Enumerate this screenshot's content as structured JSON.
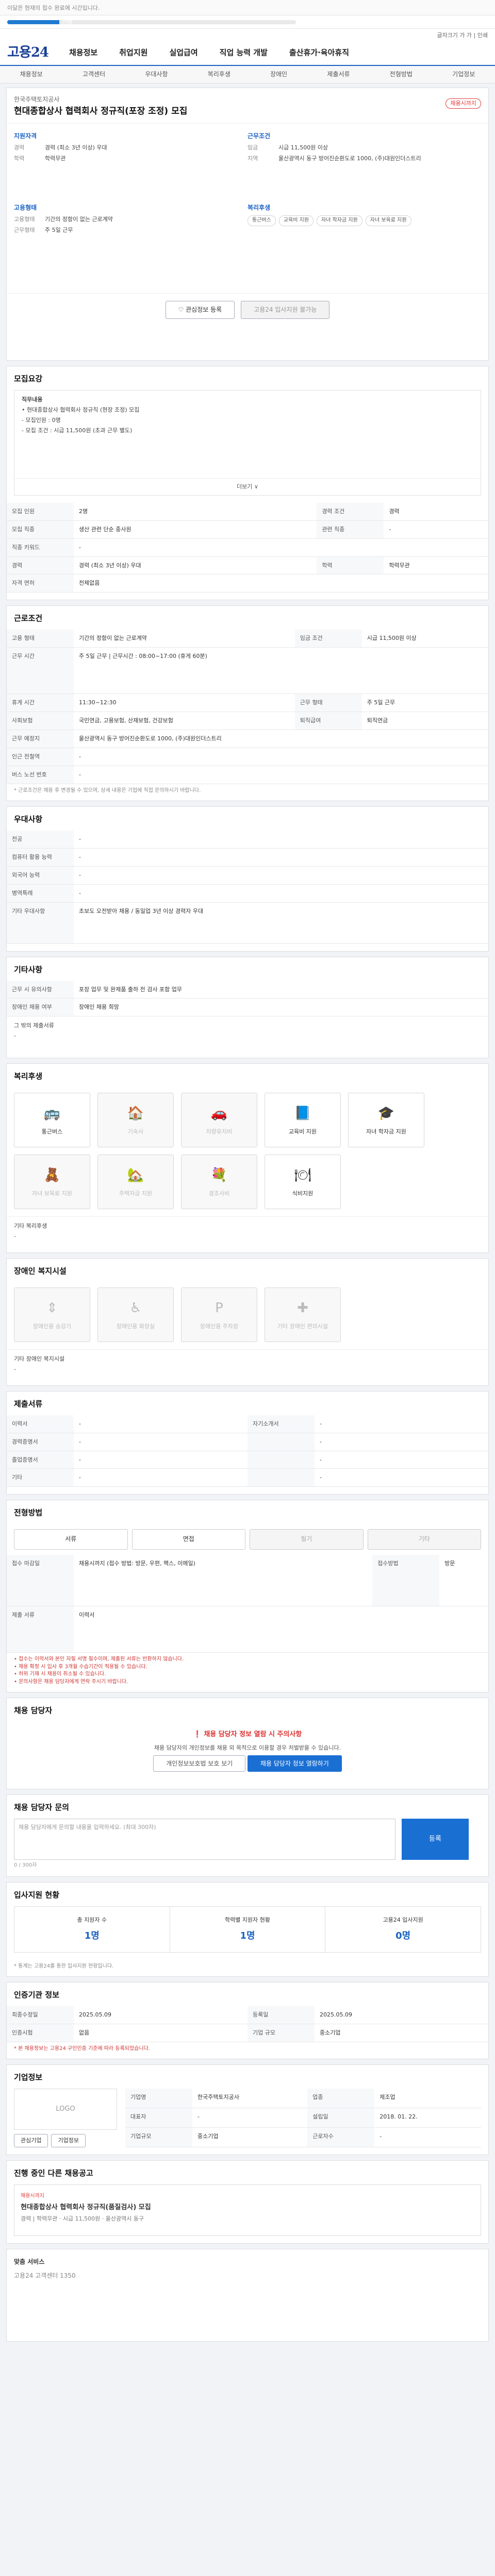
{
  "topbar": {
    "text": "이달은 현재의 접수 완료에 시간입니다."
  },
  "progress": {
    "label": "진행",
    "value": 18
  },
  "fonttools": {
    "text": "글자크기 가 가 | 인쇄"
  },
  "gnb": {
    "logo": "고용24",
    "items": [
      "채용정보",
      "취업지원",
      "실업급여",
      "직업 능력 개발",
      "출산휴가·육아휴직"
    ]
  },
  "tabs": [
    "채용정보",
    "고객센터",
    "우대사항",
    "복리후생",
    "장애인",
    "제출서류",
    "전형방법",
    "기업정보"
  ],
  "job": {
    "corp": "한국주택토지공사",
    "title": "현대종합상사 협력회사 정규직(포장 조정) 모집",
    "badge": "채용시까지",
    "qual_h": "지원자격",
    "qual": [
      [
        "경력",
        "경력 (최소 3년 이상) 우대"
      ],
      [
        "학력",
        "학력무관"
      ]
    ],
    "cond_h": "근무조건",
    "cond": [
      [
        "임금",
        "시급 11,500원 이상"
      ],
      [
        "지역",
        "울산광역시 동구 방어진순환도로 1000, (주)대원인더스트리"
      ]
    ],
    "form_h": "고용형태",
    "form": [
      [
        "고용형태",
        "기간의 정함이 없는 근로계약"
      ],
      [
        "근무형태",
        "주 5일 근무"
      ]
    ],
    "welfare_h": "복리후생",
    "welfare": [
      "통근버스",
      "교육비 지원",
      "자녀 학자금 지원",
      "자녀 보육료 지원"
    ],
    "btn_scrap": "관심정보 등록",
    "btn_apply": "고용24 입사지원 불가능"
  },
  "recruit": {
    "title": "모집요강",
    "duty_h": "직무내용",
    "duties": [
      "• 현대종합상사 협력회사 정규직 (현장 조정) 모집",
      "- 모집인원 : 0명",
      "- 모집 조건 : 시급 11,500원 (초과 근무 별도)"
    ],
    "more": "더보기 ∨",
    "rows": [
      [
        "모집 인원",
        "2명",
        "경력 조건",
        "경력"
      ],
      [
        "모집 직종",
        "생산 관련 단순 종사원",
        "관련 직종",
        "-"
      ],
      [
        "직종 키워드",
        "-",
        "",
        ""
      ],
      [
        "경력",
        "경력 (최소 3년 이상) 우대",
        "학력",
        "학력무관"
      ],
      [
        "자격 면허",
        "전체없음",
        "",
        ""
      ]
    ]
  },
  "cond": {
    "title": "근로조건",
    "rows": [
      [
        "고용 형태",
        "기간의 정함이 없는 근로계약",
        "임금 조건",
        "시급 11,500원 이상"
      ],
      [
        "근무 시간",
        "주 5일 근무 | 근무시간 : 08:00~17:00 (휴게 60분)",
        "",
        ""
      ],
      [
        "휴게 시간",
        "11:30~12:30",
        "근무 형태",
        "주 5일 근무"
      ],
      [
        "사회보험",
        "국민연금, 고용보험, 산재보험, 건강보험",
        "퇴직급여",
        "퇴직연금"
      ],
      [
        "근무 예정지",
        "울산광역시 동구 방어진순환도로 1000, (주)대원인더스트리",
        "",
        ""
      ],
      [
        "인근 전철역",
        "-",
        "",
        ""
      ],
      [
        "버스 노선 번호",
        "-",
        "",
        ""
      ]
    ],
    "note": "* 근로조건은 채용 후 변경될 수 있으며, 상세 내용은 기업에 직접 문의하시기 바랍니다."
  },
  "prefer": {
    "title": "우대사항",
    "rows": [
      [
        "전공",
        "-"
      ],
      [
        "컴퓨터 활용 능력",
        "-"
      ],
      [
        "외국어 능력",
        "-"
      ],
      [
        "병역특례",
        "-"
      ],
      [
        "기타 우대사항",
        "초보도 오전받아 채용 / 동일업 3년 이상 경력자 우대"
      ]
    ]
  },
  "etc": {
    "title": "기타사항",
    "rows": [
      [
        "근무 시 유의사항",
        "포장 업무 및 완제품 출하 전 검사 포함 업무"
      ],
      [
        "장애인 채용 여부",
        "장애인 채용 희망"
      ]
    ],
    "remark_h": "그 밖의 제출서류",
    "remark": "-"
  },
  "welfare": {
    "title": "복리후생",
    "items": [
      [
        "통근버스",
        "🚌",
        true
      ],
      [
        "기숙사",
        "🏠",
        false
      ],
      [
        "차량유지비",
        "🚗",
        false
      ],
      [
        "교육비 지원",
        "📘",
        true
      ],
      [
        "자녀 학자금 지원",
        "🎓",
        true
      ],
      [
        "자녀 보육료 지원",
        "🧸",
        false
      ],
      [
        "주택자금 지원",
        "🏡",
        false
      ],
      [
        "경조사비",
        "💐",
        false
      ],
      [
        "식비지원",
        "🍽",
        true
      ]
    ],
    "etc_h": "기타 복리후생",
    "etc": "-"
  },
  "disabled": {
    "title": "장애인 복지시설",
    "items": [
      "장애인용 승강기",
      "장애인용 화장실",
      "장애인용 주차장",
      "기타 장애인 편의시설"
    ],
    "etc_h": "기타 장애인 복지시설",
    "etc": "-"
  },
  "docs": {
    "title": "제출서류",
    "rows": [
      [
        "이력서",
        "-",
        "자기소개서",
        "-"
      ],
      [
        "경력증명서",
        "-",
        "",
        "-"
      ],
      [
        "졸업증명서",
        "-",
        "",
        "-"
      ],
      [
        "기타",
        "-",
        "",
        "-"
      ]
    ]
  },
  "process": {
    "title": "전형방법",
    "tags": [
      [
        "서류",
        true
      ],
      [
        "면접",
        true
      ],
      [
        "필기",
        false
      ],
      [
        "기타",
        false
      ]
    ],
    "rows": [
      [
        "접수 마감일",
        "채용시까지 (접수 방법: 방문, 우편, 팩스, 이메일)",
        "접수방법",
        "방문"
      ],
      [
        "제출 서류",
        "이력서",
        "",
        ""
      ]
    ],
    "notes": [
      "• 접수는 이력서와 본인 자필 서명 필수이며, 제출된 서류는 반환하지 않습니다.",
      "• 채용 확정 시 입사 후 3개월 수습기간이 적용될 수 있습니다.",
      "• 허위 기재 시 채용이 취소될 수 있습니다.",
      "• 문의사항은 채용 담당자에게 연락 주시기 바랍니다."
    ]
  },
  "contact": {
    "title": "채용 담당자",
    "alert": "채용 담당자 정보 열람 시 주의사항",
    "body": "채용 담당자의 개인정보를 채용 외 목적으로 이용할 경우 처벌받을 수 있습니다.",
    "btn1": "개인정보보호법 보호 보기",
    "btn2": "채용 담당자 정보 열람하기"
  },
  "qa": {
    "title": "채용 담당자 문의",
    "placeholder": "채용 담당자에게 문의할 내용을 입력하세요. (최대 300자)",
    "submit": "등록",
    "count": "0 / 300자"
  },
  "status": {
    "title": "입사지원 현황",
    "items": [
      [
        "총 지원자 수",
        "1명"
      ],
      [
        "학력별 지원자 현황",
        "1명"
      ],
      [
        "고용24 입사지원",
        "0명"
      ]
    ],
    "note": "* 통계는 고용24를 통한 입사지원 현황입니다."
  },
  "info": {
    "title": "인증기관 정보",
    "rows": [
      [
        "최종수정일",
        "2025.05.09",
        "등록일",
        "2025.05.09"
      ],
      [
        "인증시험",
        "없음",
        "기업 규모",
        "중소기업"
      ]
    ],
    "note": "* 본 채용정보는 고용24 구인인증 기준에 따라 등록되었습니다."
  },
  "company": {
    "title": "기업정보",
    "logo": "LOGO",
    "rows": [
      [
        "기업명",
        "한국주택토지공사",
        "업종",
        "제조업"
      ],
      [
        "대표자",
        "-",
        "설립일",
        "2018. 01. 22."
      ],
      [
        "기업규모",
        "중소기업",
        "근로자수",
        "-"
      ]
    ],
    "btns": [
      "관심기업",
      "기업정보"
    ]
  },
  "related": {
    "title": "진행 중인 다른 채용공고",
    "card_tag": "채용시까지",
    "card_title": "현대종합상사 협력회사 정규직(품질검사) 모집",
    "meta": [
      "경력 | 학력무관",
      "시급 11,500원",
      "울산광역시 동구"
    ]
  },
  "footer": {
    "title": "맞춤 서비스",
    "text": "고용24 고객센터 1350"
  }
}
